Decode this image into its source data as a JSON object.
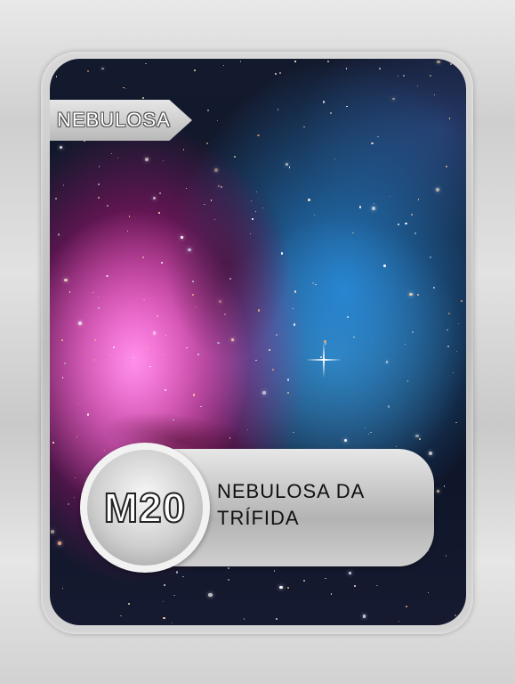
{
  "card": {
    "category": "NEBULOSA",
    "catalog_id": "M20",
    "object_name": "NEBULOSA DA TRÍFIDA",
    "image_subject": "trifid-nebula-photo"
  },
  "colors": {
    "frame": "#c8c8c8",
    "panel": "#bdbdbd",
    "nebula_pink": "#e8149a",
    "nebula_blue": "#2f8cd8"
  }
}
